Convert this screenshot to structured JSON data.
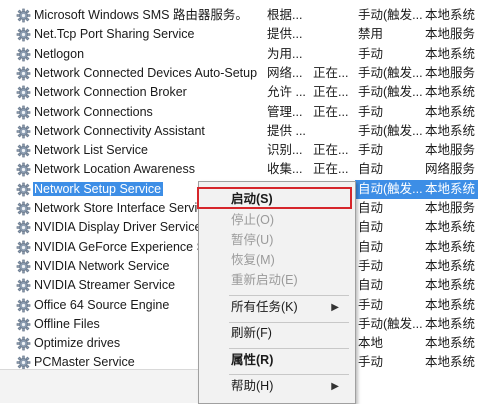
{
  "services": [
    {
      "name": "Microsoft Windows SMS 路由器服务。",
      "desc": "根据...",
      "status": "",
      "startup": "手动(触发...",
      "logon": "本地系统"
    },
    {
      "name": "Net.Tcp Port Sharing Service",
      "desc": "提供...",
      "status": "",
      "startup": "禁用",
      "logon": "本地服务"
    },
    {
      "name": "Netlogon",
      "desc": "为用...",
      "status": "",
      "startup": "手动",
      "logon": "本地系统"
    },
    {
      "name": "Network Connected Devices Auto-Setup",
      "desc": "网络...",
      "status": "正在...",
      "startup": "手动(触发...",
      "logon": "本地服务"
    },
    {
      "name": "Network Connection Broker",
      "desc": "允许 ...",
      "status": "正在...",
      "startup": "手动(触发...",
      "logon": "本地系统"
    },
    {
      "name": "Network Connections",
      "desc": "管理...",
      "status": "正在...",
      "startup": "手动",
      "logon": "本地系统"
    },
    {
      "name": "Network Connectivity Assistant",
      "desc": "提供 ...",
      "status": "",
      "startup": "手动(触发...",
      "logon": "本地系统"
    },
    {
      "name": "Network List Service",
      "desc": "识别...",
      "status": "正在...",
      "startup": "手动",
      "logon": "本地服务"
    },
    {
      "name": "Network Location Awareness",
      "desc": "收集...",
      "status": "正在...",
      "startup": "自动",
      "logon": "网络服务"
    },
    {
      "name": "Network Setup Service",
      "desc": "",
      "status": "",
      "startup": "自动(触发...",
      "logon": "本地系统"
    },
    {
      "name": "Network Store Interface Service",
      "desc": "",
      "status": "",
      "startup": "自动",
      "logon": "本地服务"
    },
    {
      "name": "NVIDIA Display Driver Service",
      "desc": "",
      "status": "",
      "startup": "自动",
      "logon": "本地系统"
    },
    {
      "name": "NVIDIA GeForce Experience Se",
      "desc": "",
      "status": "",
      "startup": "自动",
      "logon": "本地系统"
    },
    {
      "name": "NVIDIA Network Service",
      "desc": "",
      "status": "",
      "startup": "手动",
      "logon": "本地系统"
    },
    {
      "name": "NVIDIA Streamer Service",
      "desc": "",
      "status": "",
      "startup": "自动",
      "logon": "本地系统"
    },
    {
      "name": "Office 64 Source Engine",
      "desc": "",
      "status": "",
      "startup": "手动",
      "logon": "本地系统"
    },
    {
      "name": "Offline Files",
      "desc": "",
      "status": "",
      "startup": "手动(触发...",
      "logon": "本地系统"
    },
    {
      "name": "Optimize drives",
      "desc": "",
      "status": "",
      "startup": "本地",
      "logon": "本地系统"
    },
    {
      "name": "PCMaster Service",
      "desc": "",
      "status": "",
      "startup": "手动",
      "logon": "本地系统"
    }
  ],
  "selected_index": 9,
  "menu": {
    "start": "启动(S)",
    "stop": "停止(O)",
    "pause": "暂停(U)",
    "resume": "恢复(M)",
    "restart": "重新启动(E)",
    "all_tasks": "所有任务(K)",
    "refresh": "刷新(F)",
    "properties": "属性(R)",
    "help": "帮助(H)"
  },
  "colors": {
    "selection": "#3d8ee6",
    "highlight_box": "#d6262b"
  }
}
